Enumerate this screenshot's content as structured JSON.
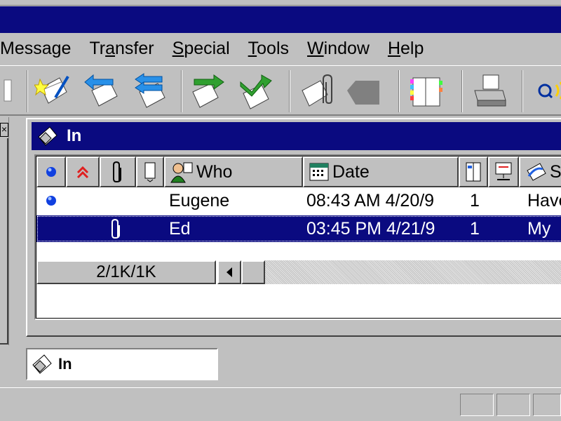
{
  "menu": {
    "items": [
      {
        "label": "Message",
        "key": "message"
      },
      {
        "label": "Transfer",
        "key": "transfer"
      },
      {
        "label": "Special",
        "key": "special"
      },
      {
        "label": "Tools",
        "key": "tools"
      },
      {
        "label": "Window",
        "key": "window"
      },
      {
        "label": "Help",
        "key": "help"
      }
    ]
  },
  "toolbar": {
    "buttons": [
      "new-message-icon",
      "reply-icon",
      "reply-all-icon",
      "forward-icon",
      "redirect-icon",
      "attach-icon",
      "delete-icon",
      "address-book-icon",
      "print-icon",
      "find-icon"
    ]
  },
  "mailbox_window": {
    "title": "In",
    "columns": {
      "status": "",
      "priority": "",
      "attachment": "",
      "label": "",
      "who": "Who",
      "date": "Date",
      "size": "",
      "server": "",
      "subject": "S"
    },
    "rows": [
      {
        "status": "unread",
        "attachment": "",
        "who": "Eugene",
        "date": "08:43 AM 4/20/9",
        "size": "1",
        "subject": "Have",
        "selected": false
      },
      {
        "status": "",
        "attachment": "paperclip",
        "who": "Ed",
        "date": "03:45 PM 4/21/9",
        "size": "1",
        "subject": "My",
        "selected": true
      }
    ],
    "status_text": "2/1K/1K"
  },
  "mailbox_tab": {
    "label": "In"
  },
  "colors": {
    "titlebar": "#0a0a80",
    "face": "#c0c0c0",
    "selection": "#0a0a80"
  }
}
